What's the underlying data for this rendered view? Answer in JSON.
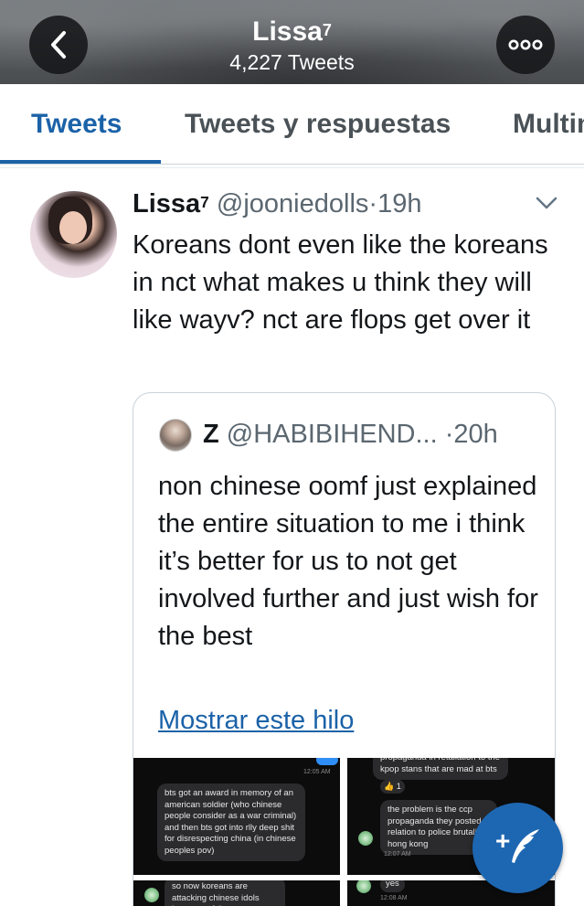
{
  "header": {
    "title": "Lissa",
    "title_sup": "7",
    "tweet_count": "4,227 Tweets",
    "back_icon": "chevron-left-icon",
    "more_icon": "more-horizontal-icon"
  },
  "tabs": [
    {
      "label": "Tweets",
      "active": true
    },
    {
      "label": "Tweets y respuestas",
      "active": false
    },
    {
      "label": "Multim",
      "active": false
    }
  ],
  "tweet": {
    "name": "Lissa",
    "name_sup": "7",
    "handle": "@jooniedolls",
    "separator": "·",
    "time": "19h",
    "text": "Koreans dont even like the koreans in nct what makes u think they will like wayv? nct are flops get over it",
    "quote": {
      "name": "Z",
      "handle": "@HABIBIHEND...",
      "separator": "·",
      "time": "20h",
      "text": "non chinese oomf just explained the entire situation to me i think it’s better for us to not get involved further and just wish for the best",
      "show_thread": "Mostrar este hilo",
      "media": {
        "shot1": {
          "time_top": "12:05 AM",
          "message": "bts got an award in memory of an american soldier (who chinese people consider as a war criminal) and then bts got into rlly deep shit for disrespecting china (in chinese peoples pov)"
        },
        "shot2": {
          "message_top": "propaganda in retaliation to the kpop stans that are mad at bts",
          "emoji": "👍",
          "count": "1",
          "message": "the problem is the ccp propaganda they posted w relation to police brutality hong kong",
          "time": "12:07 AM"
        },
        "shot3": {
          "message": "so now koreans are attacking chinese idols because of that"
        },
        "shot4": {
          "message": "yes",
          "time": "12:08 AM"
        }
      }
    }
  },
  "fab": {
    "icon": "compose-tweet-icon",
    "plus": "+"
  },
  "colors": {
    "accent": "#1b62a8",
    "fab": "#1d67b2",
    "text": "#14171a",
    "muted": "#5b6770"
  }
}
